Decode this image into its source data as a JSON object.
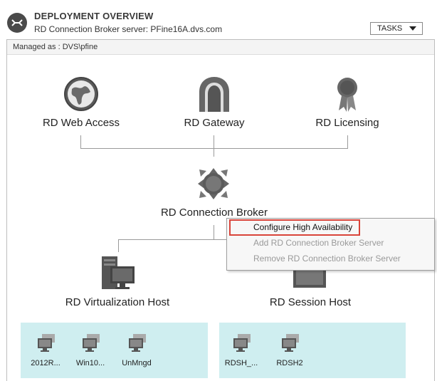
{
  "header": {
    "title": "DEPLOYMENT OVERVIEW",
    "subtitle": "RD Connection Broker server: PFine16A.dvs.com",
    "tasks_label": "TASKS"
  },
  "managed_as": "Managed as : DVS\\pfine",
  "roles": {
    "web_access": "RD Web Access",
    "gateway": "RD Gateway",
    "licensing": "RD Licensing",
    "connection_broker": "RD Connection Broker",
    "virtualization_host": "RD Virtualization Host",
    "session_host": "RD Session Host"
  },
  "virtualization_servers": [
    "2012R...",
    "Win10...",
    "UnMngd"
  ],
  "session_servers": [
    "RDSH_...",
    "RDSH2"
  ],
  "context_menu": [
    {
      "label": "Configure High Availability",
      "enabled": true
    },
    {
      "label": "Add RD Connection Broker Server",
      "enabled": false
    },
    {
      "label": "Remove RD Connection Broker Server",
      "enabled": false
    }
  ],
  "colors": {
    "panel": "#cfeef0",
    "highlight_border": "#d9443a",
    "line": "#9a9a9a"
  }
}
